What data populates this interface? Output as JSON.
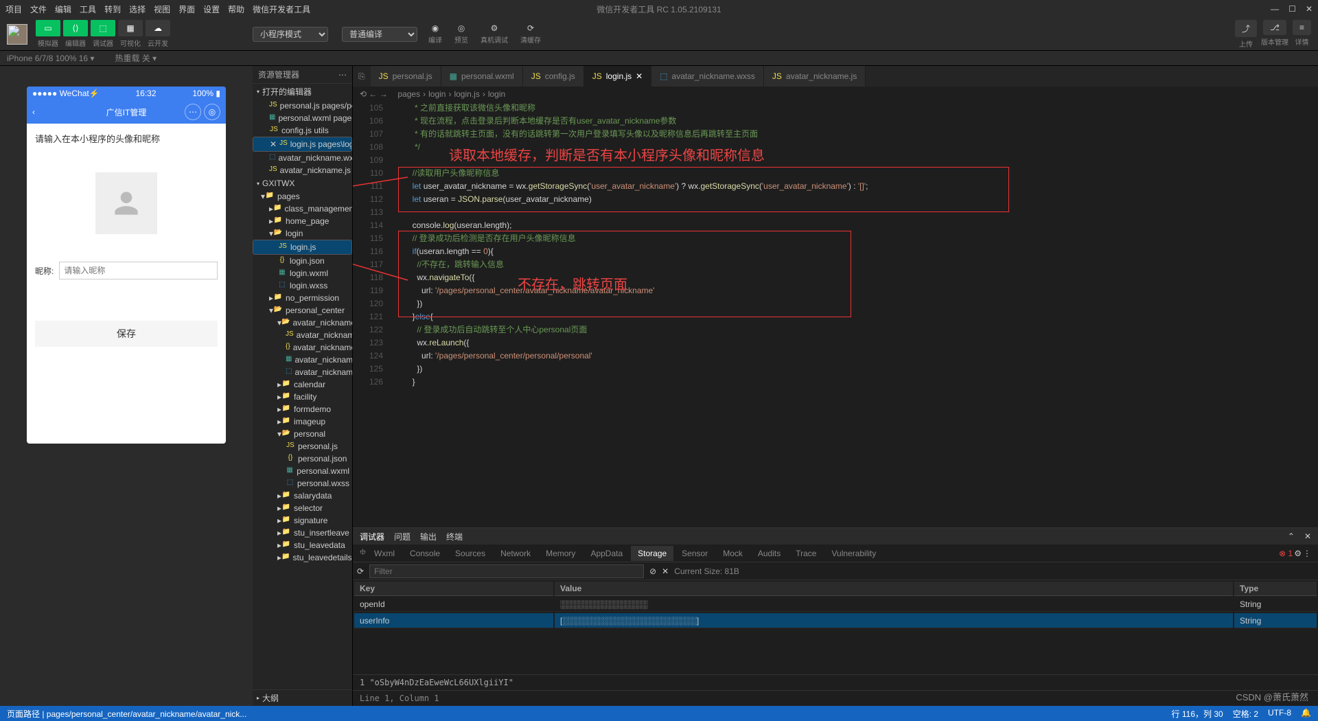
{
  "app": {
    "title": "微信开发者工具 RC 1.05.2109131"
  },
  "menu": [
    "项目",
    "文件",
    "编辑",
    "工具",
    "转到",
    "选择",
    "视图",
    "界面",
    "设置",
    "帮助",
    "微信开发者工具"
  ],
  "toolbar": {
    "labels": {
      "sim": "模拟器",
      "editor": "编辑器",
      "debug": "调试器",
      "vis": "可视化",
      "cloud": "云开发"
    },
    "mode": "小程序模式",
    "compile": "普通编译",
    "mid": [
      "编译",
      "预览",
      "真机调试",
      "清缓存"
    ],
    "right": {
      "upload": "上传",
      "version": "版本管理",
      "detail": "详情"
    }
  },
  "subhdr": {
    "device": "iPhone 6/7/8 100% 16 ▾",
    "hot": "热重载 关 ▾"
  },
  "phone": {
    "carrier": "●●●●● WeChat⚡",
    "time": "16:32",
    "battery": "100% ▮",
    "title": "广信IT管理",
    "tip": "请输入在本小程序的头像和昵称",
    "nick_label": "昵称:",
    "nick_ph": "请输入昵称",
    "save": "保存"
  },
  "explorer": {
    "title": "资源管理器",
    "open": "打开的编辑器",
    "project": "GXITWX",
    "outline": "大纲",
    "open_files": [
      "personal.js pages/perso...",
      "personal.wxml pages/p...",
      "config.js utils",
      "login.js pages\\login",
      "avatar_nickname.wxss...",
      "avatar_nickname.js pag..."
    ],
    "tree": {
      "pages": "pages",
      "class_management": "class_management",
      "home_page": "home_page",
      "login": "login",
      "login_js": "login.js",
      "login_json": "login.json",
      "login_wxml": "login.wxml",
      "login_wxss": "login.wxss",
      "no_permission": "no_permission",
      "personal_center": "personal_center",
      "avatar_nickname": "avatar_nickname",
      "an_js": "avatar_nickname.js",
      "an_json": "avatar_nickname.j...",
      "an_wxml": "avatar_nickname.w...",
      "an_wxss": "avatar_nickname.w...",
      "calendar": "calendar",
      "facility": "facility",
      "formdemo": "formdemo",
      "imageup": "imageup",
      "personal": "personal",
      "p_js": "personal.js",
      "p_json": "personal.json",
      "p_wxml": "personal.wxml",
      "p_wxss": "personal.wxss",
      "salarydata": "salarydata",
      "selector": "selector",
      "signature": "signature",
      "stu_insertleave": "stu_insertleave",
      "stu_leavedata": "stu_leavedata",
      "stu_leavedetails": "stu_leavedetails"
    }
  },
  "tabs": [
    {
      "name": "personal.js"
    },
    {
      "name": "personal.wxml"
    },
    {
      "name": "config.js"
    },
    {
      "name": "login.js",
      "active": true
    },
    {
      "name": "avatar_nickname.wxss"
    },
    {
      "name": "avatar_nickname.js"
    }
  ],
  "breadcrumb": [
    "pages",
    "login",
    "login.js",
    "login"
  ],
  "code": {
    "start": 105,
    "lines": [
      {
        "cls": "c-cm",
        "t": "         * 之前直接获取该微信头像和昵称"
      },
      {
        "cls": "c-cm",
        "t": "         * 现在流程，点击登录后判断本地缓存是否有user_avatar_nickname参数"
      },
      {
        "cls": "c-cm",
        "t": "         * 有的话就跳转主页面，没有的话跳转第一次用户登录填写头像以及昵称信息后再跳转至主页面"
      },
      {
        "cls": "c-cm",
        "t": "         */"
      },
      {
        "cls": "",
        "t": ""
      },
      {
        "cls": "c-cm",
        "t": "        //读取用户头像昵称信息"
      },
      {
        "t": "        <span class='c-kw'>let</span> user_avatar_nickname = wx.<span class='c-fn'>getStorageSync</span>(<span class='c-str'>'user_avatar_nickname'</span>) ? wx.<span class='c-fn'>getStorageSync</span>(<span class='c-str'>'user_avatar_nickname'</span>) : <span class='c-str'>'[]'</span>;"
      },
      {
        "t": "        <span class='c-kw'>let</span> useran = <span class='c-fn'>JSON.parse</span>(user_avatar_nickname)"
      },
      {
        "cls": "",
        "t": ""
      },
      {
        "t": "        console.<span class='c-fn'>log</span>(useran.length);"
      },
      {
        "cls": "c-cm",
        "t": "        // 登录成功后检测是否存在用户头像昵称信息"
      },
      {
        "t": "        <span class='c-kw'>if</span>(useran.length == <span class='c-str'>0</span>){"
      },
      {
        "cls": "c-cm",
        "t": "          //不存在，跳转输入信息"
      },
      {
        "t": "          wx.<span class='c-fn'>navigateTo</span>({"
      },
      {
        "t": "            url: <span class='c-str'>'/pages/personal_center/avatar_nickname/avatar_nickname'</span>"
      },
      {
        "t": "          })"
      },
      {
        "t": "        }<span class='c-kw'>else</span>{"
      },
      {
        "cls": "c-cm",
        "t": "          // 登录成功后自动跳转至个人中心personal页面"
      },
      {
        "t": "          wx.<span class='c-fn'>reLaunch</span>({"
      },
      {
        "t": "            url: <span class='c-str'>'/pages/personal_center/personal/personal'</span>"
      },
      {
        "t": "          })"
      },
      {
        "t": "        }"
      }
    ]
  },
  "annot": {
    "a1": "读取本地缓存，判断是否有本小程序头像和昵称信息",
    "a2": "不存在，跳转页面"
  },
  "devtools": {
    "hdr": [
      "调试器",
      "问题",
      "输出",
      "终端"
    ],
    "tabs": [
      "Wxml",
      "Console",
      "Sources",
      "Network",
      "Memory",
      "AppData",
      "Storage",
      "Sensor",
      "Mock",
      "Audits",
      "Trace",
      "Vulnerability"
    ],
    "filter_ph": "Filter",
    "size": "Current Size: 81B",
    "th": {
      "key": "Key",
      "value": "Value",
      "type": "Type"
    },
    "rows": [
      {
        "k": "openId",
        "v": "░░░░░░░░░░░░░░░",
        "t": "String"
      },
      {
        "k": "userInfo",
        "v": "[░░░░░░░░░░░░░░░░░░░░░░░]",
        "t": "String",
        "sel": true
      }
    ],
    "detail": "1   \"oSbyW4nDzEaEweWcL66UXlgiiYI\"",
    "cursor": "Line 1, Column 1"
  },
  "status": {
    "path": "页面路径  |  pages/personal_center/avatar_nickname/avatar_nick...",
    "pos": "行 116，列 30",
    "tab": "空格: 2",
    "enc": "UTF-8"
  },
  "watermark": "CSDN @萧氏萧然"
}
